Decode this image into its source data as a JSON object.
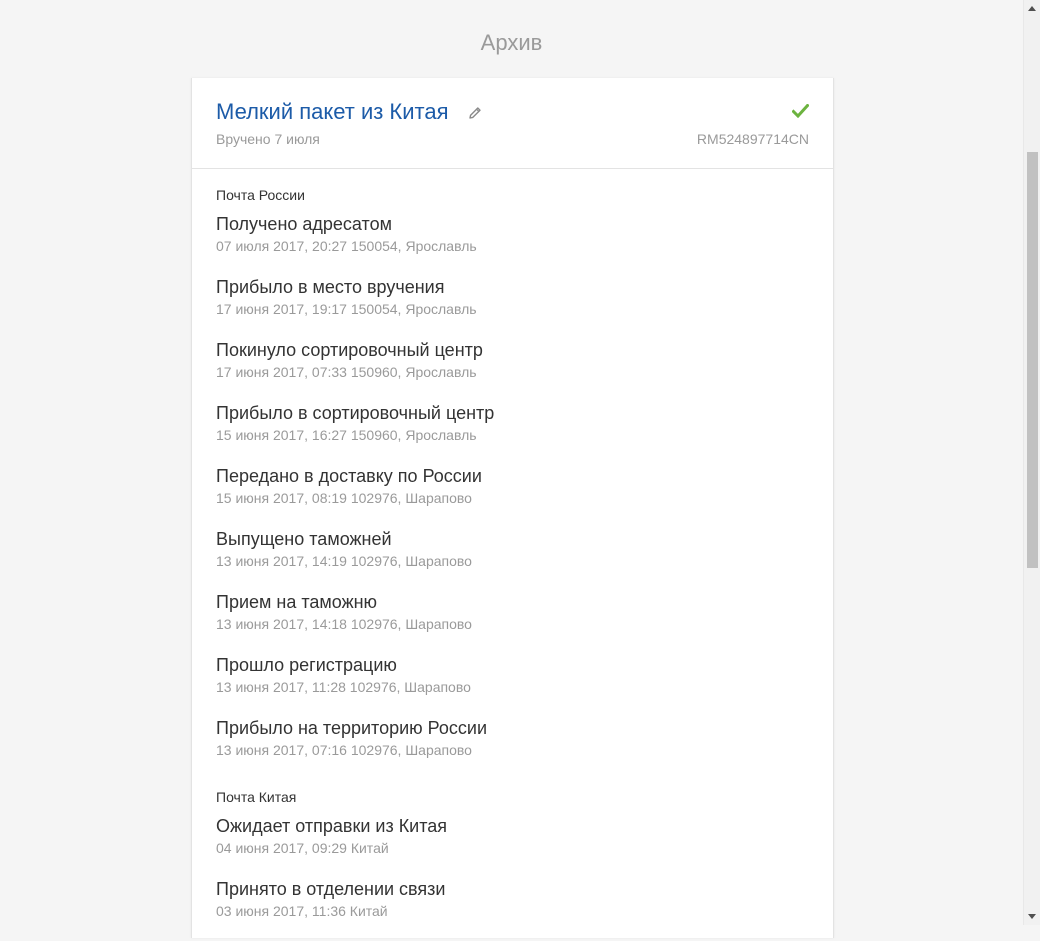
{
  "page": {
    "title": "Архив"
  },
  "package": {
    "name": "Мелкий пакет из Китая",
    "status": "Вручено 7 июля",
    "track_number": "RM524897714CN",
    "status_color": "#6cb33f",
    "name_color": "#1c5ba8"
  },
  "groups": [
    {
      "title": "Почта России",
      "events": [
        {
          "title": "Получено адресатом",
          "meta": "07 июля 2017, 20:27 150054, Ярославль"
        },
        {
          "title": "Прибыло в место вручения",
          "meta": "17 июня 2017, 19:17 150054, Ярославль"
        },
        {
          "title": "Покинуло сортировочный центр",
          "meta": "17 июня 2017, 07:33 150960, Ярославль"
        },
        {
          "title": "Прибыло в сортировочный центр",
          "meta": "15 июня 2017, 16:27 150960, Ярославль"
        },
        {
          "title": "Передано в доставку по России",
          "meta": "15 июня 2017, 08:19 102976, Шарапово"
        },
        {
          "title": "Выпущено таможней",
          "meta": "13 июня 2017, 14:19 102976, Шарапово"
        },
        {
          "title": "Прием на таможню",
          "meta": "13 июня 2017, 14:18 102976, Шарапово"
        },
        {
          "title": "Прошло регистрацию",
          "meta": "13 июня 2017, 11:28 102976, Шарапово"
        },
        {
          "title": "Прибыло на территорию России",
          "meta": "13 июня 2017, 07:16 102976, Шарапово"
        }
      ]
    },
    {
      "title": "Почта Китая",
      "events": [
        {
          "title": "Ожидает отправки из Китая",
          "meta": "04 июня 2017, 09:29 Китай"
        },
        {
          "title": "Принято в отделении связи",
          "meta": "03 июня 2017, 11:36 Китай"
        }
      ]
    }
  ],
  "icons": {
    "edit": "pencil-icon",
    "status": "checkmark-icon"
  }
}
